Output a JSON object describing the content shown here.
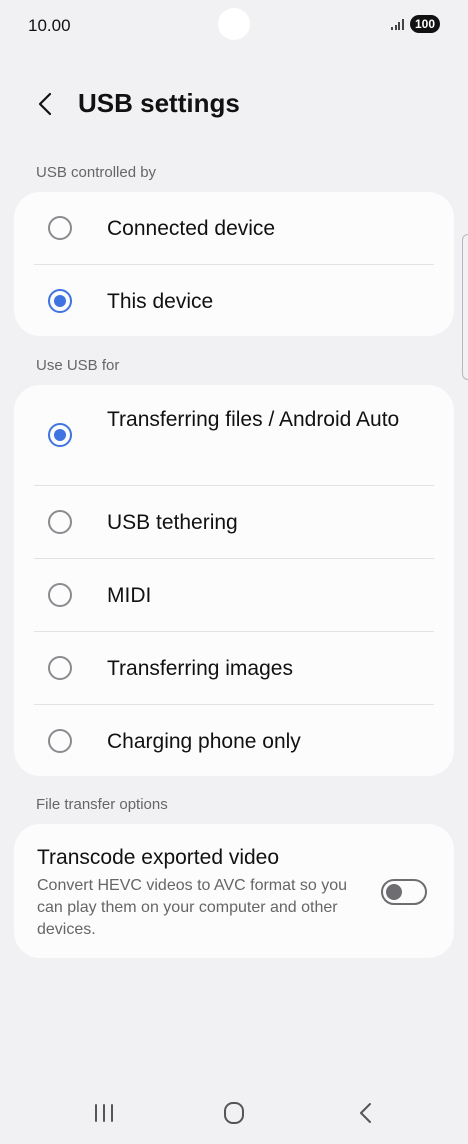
{
  "status_bar": {
    "time": "10.00",
    "battery": "100"
  },
  "header": {
    "title": "USB settings"
  },
  "usb_controlled_by": {
    "label": "USB controlled by",
    "options": [
      {
        "label": "Connected device",
        "selected": false
      },
      {
        "label": "This device",
        "selected": true
      }
    ]
  },
  "use_usb_for": {
    "label": "Use USB for",
    "options": [
      {
        "label": "Transferring files / Android Auto",
        "selected": true
      },
      {
        "label": "USB tethering",
        "selected": false
      },
      {
        "label": "MIDI",
        "selected": false
      },
      {
        "label": "Transferring images",
        "selected": false
      },
      {
        "label": "Charging phone only",
        "selected": false
      }
    ]
  },
  "file_transfer_options": {
    "label": "File transfer options",
    "title": "Transcode exported video",
    "description": "Convert HEVC videos to AVC format so you can play them on your computer and other devices.",
    "toggle_on": false
  },
  "colors": {
    "accent": "#3e73e0",
    "background": "#f1f1f3",
    "card": "#fcfcfd"
  }
}
